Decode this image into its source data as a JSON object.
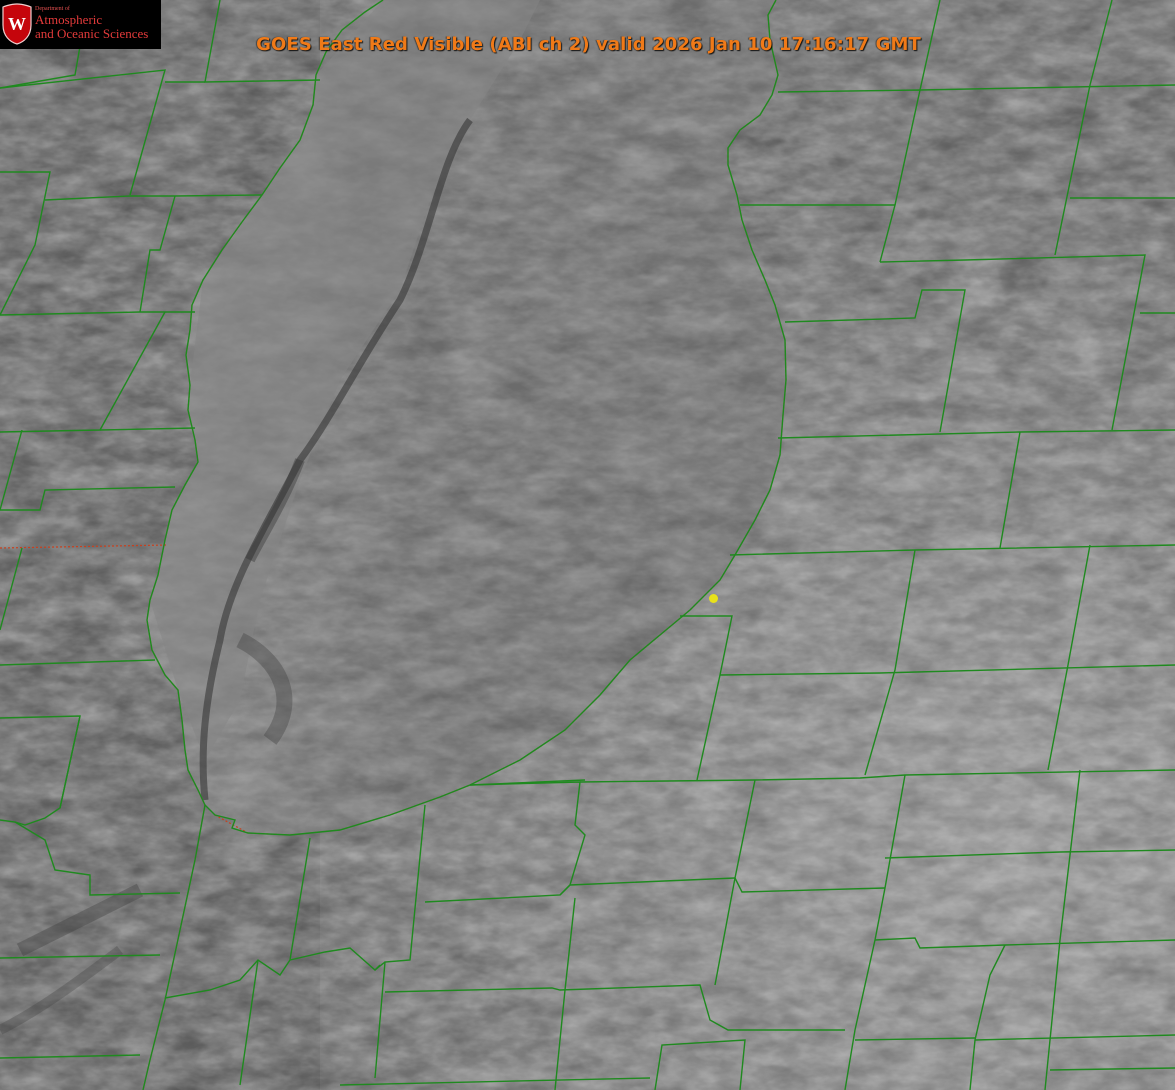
{
  "title": "GOES East Red Visible (ABI ch 2) valid 2026 Jan 10 17:16:17 GMT",
  "logo": {
    "department_line": "Department of",
    "name_line1": "Atmospheric",
    "name_line2": "and Oceanic Sciences",
    "crest_letter": "W"
  },
  "colors": {
    "county_borders": "#1f8a1f",
    "state_border": "#c8401e",
    "title": "#f07a18",
    "marker": "#e8e21a",
    "logo_text": "#e23a3a"
  },
  "imagery": {
    "satellite": "GOES East",
    "channel": "Red Visible (ABI ch 2)"
  },
  "marker": {
    "type": "yellow-dot"
  }
}
